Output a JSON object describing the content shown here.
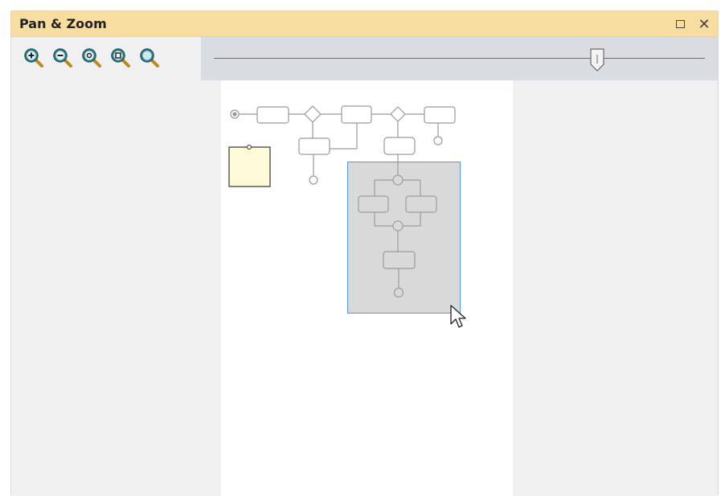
{
  "window": {
    "title": "Pan & Zoom",
    "controls": {
      "maximize_icon": "maximize-icon",
      "close_icon": "close-icon",
      "close_glyph": "✕"
    }
  },
  "toolbar": {
    "buttons": [
      {
        "icon": "zoom-in-icon"
      },
      {
        "icon": "zoom-out-icon"
      },
      {
        "icon": "zoom-fit-icon"
      },
      {
        "icon": "zoom-page-icon"
      },
      {
        "icon": "zoom-normal-icon"
      }
    ]
  },
  "zoom_slider": {
    "level": 0.78
  },
  "colors": {
    "titlebar": "#f7dda0",
    "slider_bg": "#d9dde2",
    "viewport_border": "#4a98e6",
    "note_fill": "#fffbd8",
    "shape_stroke": "#9a9a9a"
  }
}
